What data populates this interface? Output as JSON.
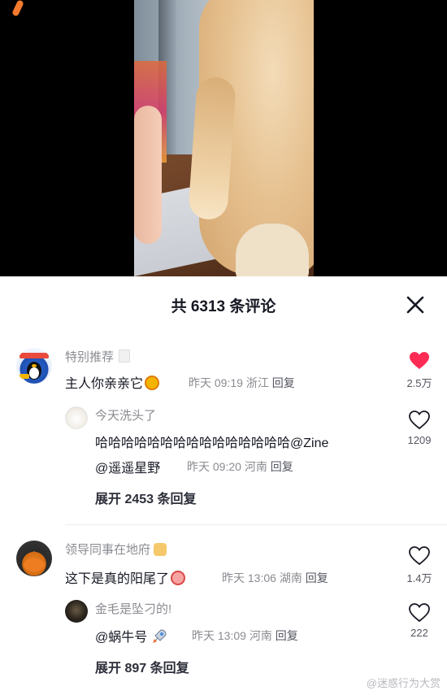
{
  "comments_panel": {
    "title": "共 6313 条评论"
  },
  "comments": [
    {
      "username": "特别推荐",
      "text": "主人你亲亲它",
      "time": "昨天 09:19",
      "location": "浙江",
      "reply_label": "回复",
      "likes": "2.5万",
      "liked": true,
      "replies": [
        {
          "username": "今天洗头了",
          "text": "哈哈哈哈哈哈哈哈哈哈哈哈哈哈哈",
          "mention": "@Zine",
          "mention2": "@遥遥星野",
          "time": "昨天 09:20",
          "location": "河南",
          "reply_label": "回复",
          "likes": "1209"
        }
      ],
      "expand_label": "展开 2453 条回复"
    },
    {
      "username": "领导同事在地府",
      "text": "这下是真的阳尾了",
      "time": "昨天 13:06",
      "location": "湖南",
      "reply_label": "回复",
      "likes": "1.4万",
      "replies": [
        {
          "username": "金毛是坠刁的!",
          "mention": "@蜗牛号",
          "time": "昨天 13:09",
          "location": "河南",
          "reply_label": "回复",
          "likes": "222"
        }
      ],
      "expand_label": "展开 897 条回复"
    }
  ],
  "colors": {
    "like_red": "#fe2c55",
    "text_primary": "#161823",
    "text_secondary": "#8a8b91"
  },
  "watermark": "@迷惑行为大赏"
}
